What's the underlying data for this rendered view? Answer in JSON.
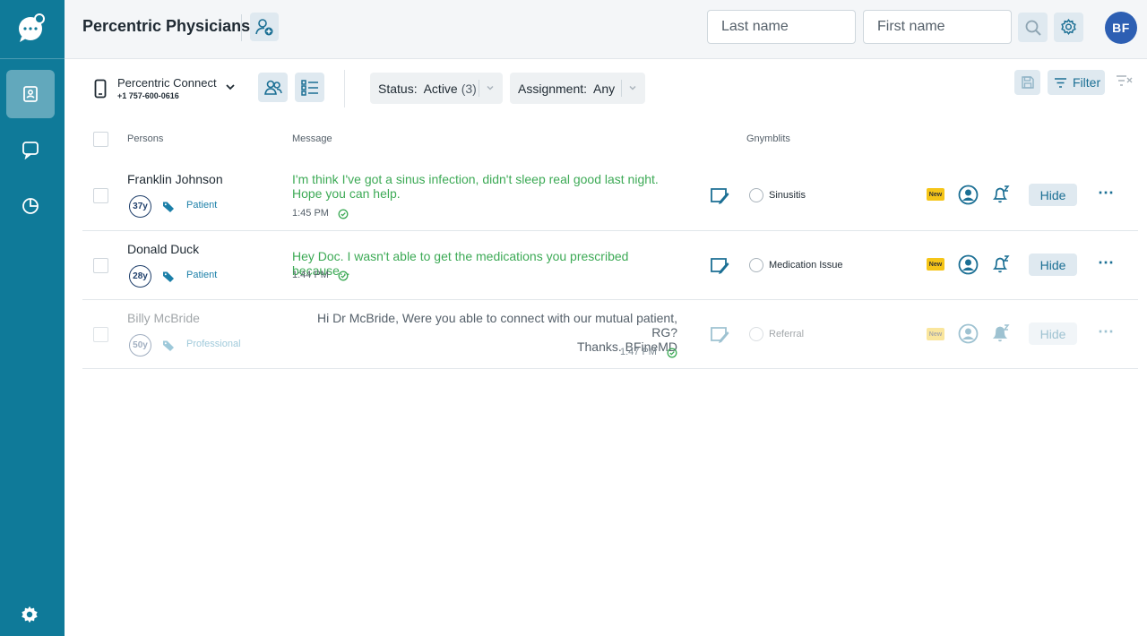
{
  "header": {
    "title": "Percentric Physicians",
    "last_name_placeholder": "Last name",
    "first_name_placeholder": "First name",
    "avatar_initials": "BF"
  },
  "toolbar": {
    "connect_name": "Percentric Connect",
    "connect_phone": "+1 757-600-0616",
    "status_label": "Status:",
    "status_value": "Active",
    "status_count": "(3)",
    "assignment_label": "Assignment:",
    "assignment_value": "Any",
    "filter_label": "Filter"
  },
  "table": {
    "headers": {
      "persons": "Persons",
      "message": "Message",
      "gymblits": "Gnymblits"
    },
    "rows": [
      {
        "name": "Franklin Johnson",
        "age": "37y",
        "tag": "Patient",
        "message": "I'm think I've got a sinus infection, didn't sleep real good last night. Hope you can help.",
        "time": "1:45 PM",
        "gymblit": "Sinusitis",
        "new_badge": "New",
        "hide_label": "Hide",
        "more": "⋯"
      },
      {
        "name": "Donald Duck",
        "age": "28y",
        "tag": "Patient",
        "message": "Hey Doc. I wasn't able to get the medications you prescribed because...",
        "time": "1:44 PM",
        "gymblit": "Medication Issue",
        "new_badge": "New",
        "hide_label": "Hide",
        "more": "⋯"
      },
      {
        "name": "Billy McBride",
        "age": "50y",
        "tag": "Professional",
        "message_line1": "Hi Dr McBride, Were you able to connect with our mutual patient, RG?",
        "message_line2": "Thanks. BFineMD",
        "time": "1:47 PM",
        "gymblit": "Referral",
        "new_badge": "New",
        "hide_label": "Hide",
        "more": "⋯"
      }
    ]
  },
  "colors": {
    "sidebar": "#0f7a99",
    "accent": "#1b6f94",
    "message_green": "#3daa56",
    "avatar": "#2d5fb3",
    "new_badge": "#f5c518"
  },
  "icons": {
    "sidebar": [
      "chat-logo-icon",
      "contacts-icon",
      "chat-bubble-icon",
      "pie-chart-icon",
      "settings-gear-icon"
    ],
    "header": [
      "add-person-icon",
      "search-icon",
      "settings-gear-icon"
    ],
    "toolbar": [
      "phone-icon",
      "chevron-down-icon",
      "group-view-icon",
      "list-view-icon",
      "save-icon",
      "filter-icon",
      "clear-filter-icon"
    ],
    "row": [
      "checkbox-icon",
      "tag-icon",
      "check-circle-icon",
      "note-icon",
      "radio-icon",
      "person-circle-icon",
      "bell-icon",
      "more-icon"
    ]
  }
}
